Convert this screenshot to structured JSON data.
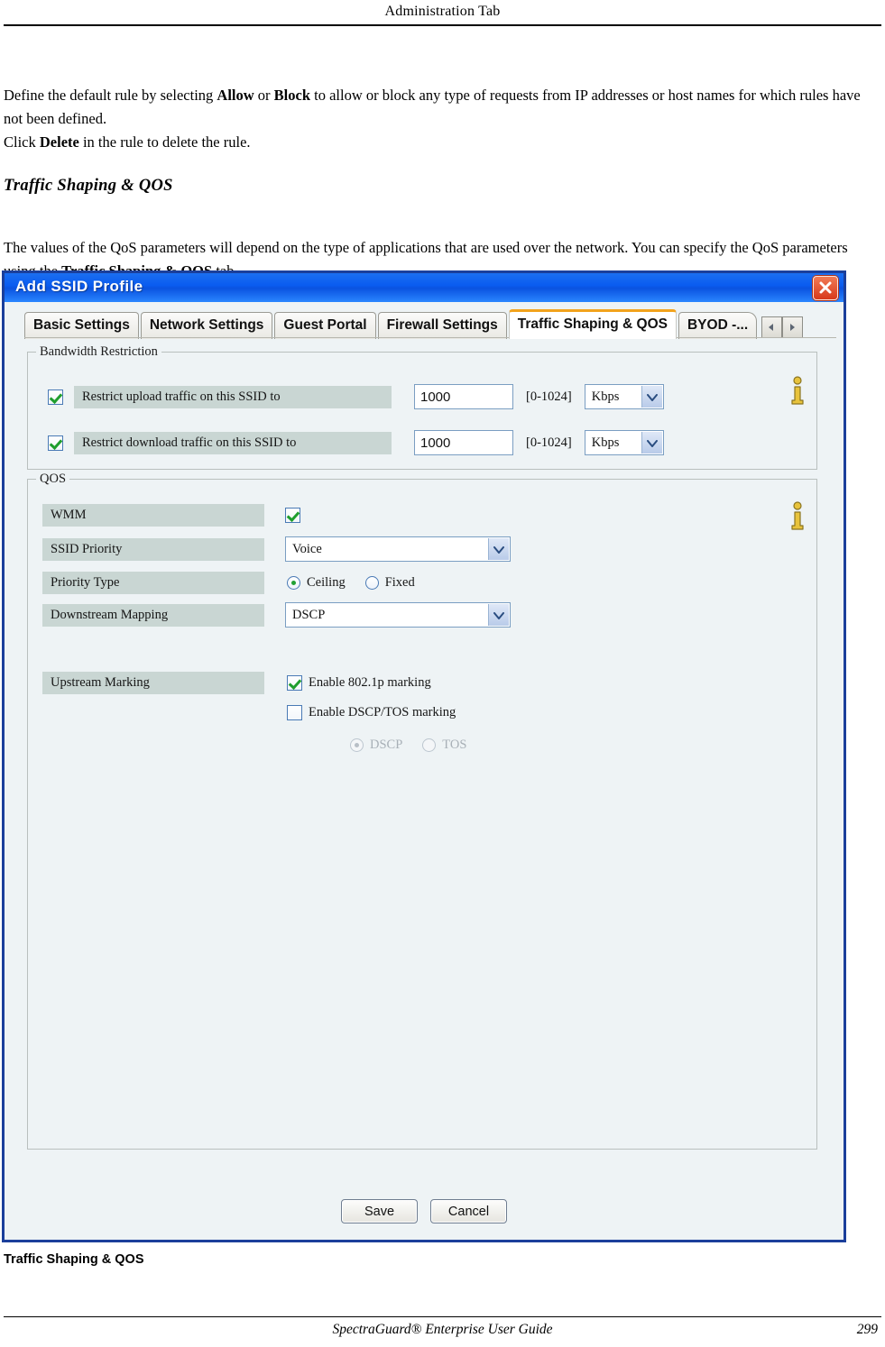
{
  "page": {
    "running_head": "Administration Tab",
    "paragraph1_parts": [
      {
        "t": "Define the default rule by selecting ",
        "b": false
      },
      {
        "t": "Allow",
        "b": true
      },
      {
        "t": " or ",
        "b": false
      },
      {
        "t": "Block",
        "b": true
      },
      {
        "t": " to allow or block any type of requests from IP addresses or host names for which rules have not been defined.",
        "b": false
      }
    ],
    "paragraph2_parts": [
      {
        "t": "Click ",
        "b": false
      },
      {
        "t": "Delete",
        "b": true
      },
      {
        "t": " in the rule to delete the rule.",
        "b": false
      }
    ],
    "section_heading": "Traffic Shaping & QOS",
    "paragraph3_parts": [
      {
        "t": "The values of the QoS parameters will depend on the type of applications that are used over the network. You can specify the QoS parameters using the ",
        "b": false
      },
      {
        "t": "Traffic Shaping & QOS",
        "b": true
      },
      {
        "t": " tab.",
        "b": false
      }
    ],
    "figure_caption": "Traffic Shaping & QOS",
    "footer_title": "SpectraGuard®  Enterprise User Guide",
    "page_number": "299"
  },
  "dialog": {
    "title": "Add SSID Profile",
    "close_label": "close-icon",
    "accent_color": "#f2a31c",
    "titlebar_color": "#0a5cf0",
    "border_color": "#1b3f9b",
    "tabs": [
      {
        "label": "Basic Settings",
        "active": false
      },
      {
        "label": "Network Settings",
        "active": false
      },
      {
        "label": "Guest Portal",
        "active": false
      },
      {
        "label": "Firewall Settings",
        "active": false
      },
      {
        "label": "Traffic Shaping & QOS",
        "active": true
      },
      {
        "label": "BYOD -...",
        "active": false
      }
    ],
    "tab_scroll_left": "◄",
    "tab_scroll_right": "►"
  },
  "bandwidth": {
    "legend": "Bandwidth Restriction",
    "rows": [
      {
        "checked": true,
        "label": "Restrict upload traffic on this SSID to",
        "value": "1000",
        "range": "[0-1024]",
        "unit": "Kbps"
      },
      {
        "checked": true,
        "label": "Restrict download traffic on this SSID to",
        "value": "1000",
        "range": "[0-1024]",
        "unit": "Kbps"
      }
    ],
    "info_icon": "info-icon"
  },
  "qos": {
    "legend": "QOS",
    "wmm_label": "WMM",
    "wmm_checked": true,
    "ssid_priority_label": "SSID Priority",
    "ssid_priority_value": "Voice",
    "priority_type_label": "Priority Type",
    "priority_type_options": [
      {
        "label": "Ceiling",
        "selected": true
      },
      {
        "label": "Fixed",
        "selected": false
      }
    ],
    "downstream_mapping_label": "Downstream Mapping",
    "downstream_mapping_value": "DSCP",
    "upstream_marking_label": "Upstream Marking",
    "enable_8021p_label": "Enable 802.1p marking",
    "enable_8021p_checked": true,
    "enable_dscptos_label": "Enable DSCP/TOS marking",
    "enable_dscptos_checked": false,
    "marking_type_options": [
      {
        "label": "DSCP",
        "selected": true,
        "disabled": true
      },
      {
        "label": "TOS",
        "selected": false,
        "disabled": true
      }
    ],
    "info_icon": "info-icon"
  },
  "buttons": {
    "save": "Save",
    "cancel": "Cancel"
  }
}
